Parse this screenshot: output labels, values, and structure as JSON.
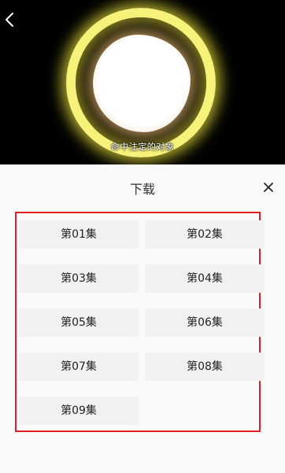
{
  "video": {
    "subtitle": "命中注定的对象"
  },
  "sheet": {
    "title": "下载",
    "episodes": [
      "第01集",
      "第02集",
      "第03集",
      "第04集",
      "第05集",
      "第06集",
      "第07集",
      "第08集",
      "第09集"
    ]
  },
  "icons": {
    "back": "chevron-left-icon",
    "close": "close-icon"
  },
  "colors": {
    "highlight_border": "#e02020",
    "episode_bg": "#f1f1f1",
    "ring": "#f7f27a"
  }
}
